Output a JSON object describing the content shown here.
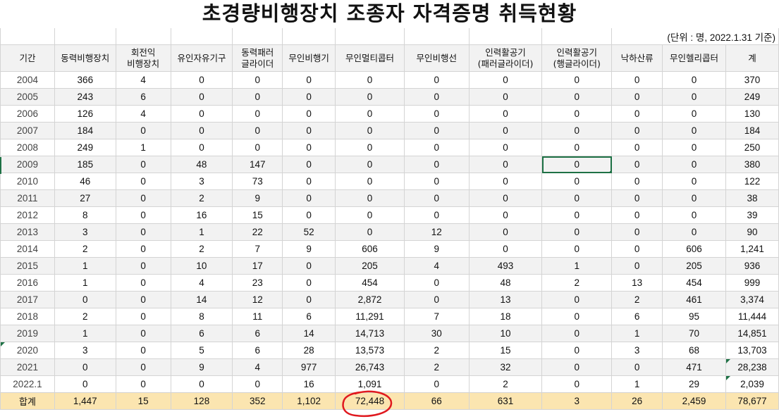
{
  "title": "초경량비행장치 조종자 자격증명 취득현황",
  "unit_note": "(단위 : 명, 2022.1.31 기준)",
  "headers": [
    "기간",
    "동력비행장치",
    "회전익\n비행장치",
    "유인자유기구",
    "동력패러\n글라이더",
    "무인비행기",
    "무인멀티콥터",
    "무인비행선",
    "인력활공기\n(패러글라이더)",
    "인력활공기\n(행글라이더)",
    "낙하산류",
    "무인헬리콥터",
    "계"
  ],
  "rows": [
    [
      "2004",
      "366",
      "4",
      "0",
      "0",
      "0",
      "0",
      "0",
      "0",
      "0",
      "0",
      "0",
      "370"
    ],
    [
      "2005",
      "243",
      "6",
      "0",
      "0",
      "0",
      "0",
      "0",
      "0",
      "0",
      "0",
      "0",
      "249"
    ],
    [
      "2006",
      "126",
      "4",
      "0",
      "0",
      "0",
      "0",
      "0",
      "0",
      "0",
      "0",
      "0",
      "130"
    ],
    [
      "2007",
      "184",
      "0",
      "0",
      "0",
      "0",
      "0",
      "0",
      "0",
      "0",
      "0",
      "0",
      "184"
    ],
    [
      "2008",
      "249",
      "1",
      "0",
      "0",
      "0",
      "0",
      "0",
      "0",
      "0",
      "0",
      "0",
      "250"
    ],
    [
      "2009",
      "185",
      "0",
      "48",
      "147",
      "0",
      "0",
      "0",
      "0",
      "0",
      "0",
      "0",
      "380"
    ],
    [
      "2010",
      "46",
      "0",
      "3",
      "73",
      "0",
      "0",
      "0",
      "0",
      "0",
      "0",
      "0",
      "122"
    ],
    [
      "2011",
      "27",
      "0",
      "2",
      "9",
      "0",
      "0",
      "0",
      "0",
      "0",
      "0",
      "0",
      "38"
    ],
    [
      "2012",
      "8",
      "0",
      "16",
      "15",
      "0",
      "0",
      "0",
      "0",
      "0",
      "0",
      "0",
      "39"
    ],
    [
      "2013",
      "3",
      "0",
      "1",
      "22",
      "52",
      "0",
      "12",
      "0",
      "0",
      "0",
      "0",
      "90"
    ],
    [
      "2014",
      "2",
      "0",
      "2",
      "7",
      "9",
      "606",
      "9",
      "0",
      "0",
      "0",
      "606",
      "1,241"
    ],
    [
      "2015",
      "1",
      "0",
      "10",
      "17",
      "0",
      "205",
      "4",
      "493",
      "1",
      "0",
      "205",
      "936"
    ],
    [
      "2016",
      "1",
      "0",
      "4",
      "23",
      "0",
      "454",
      "0",
      "48",
      "2",
      "13",
      "454",
      "999"
    ],
    [
      "2017",
      "0",
      "0",
      "14",
      "12",
      "0",
      "2,872",
      "0",
      "13",
      "0",
      "2",
      "461",
      "3,374"
    ],
    [
      "2018",
      "2",
      "0",
      "8",
      "11",
      "6",
      "11,291",
      "7",
      "18",
      "0",
      "6",
      "95",
      "11,444"
    ],
    [
      "2019",
      "1",
      "0",
      "6",
      "6",
      "14",
      "14,713",
      "30",
      "10",
      "0",
      "1",
      "70",
      "14,851"
    ],
    [
      "2020",
      "3",
      "0",
      "5",
      "6",
      "28",
      "13,573",
      "2",
      "15",
      "0",
      "3",
      "68",
      "13,703"
    ],
    [
      "2021",
      "0",
      "0",
      "9",
      "4",
      "977",
      "26,743",
      "2",
      "32",
      "0",
      "0",
      "471",
      "28,238"
    ],
    [
      "2022.1",
      "0",
      "0",
      "0",
      "0",
      "16",
      "1,091",
      "0",
      "2",
      "0",
      "1",
      "29",
      "2,039"
    ]
  ],
  "total": [
    "합계",
    "1,447",
    "15",
    "128",
    "352",
    "1,102",
    "72,448",
    "66",
    "631",
    "3",
    "26",
    "2,459",
    "78,677"
  ],
  "selected_cell": {
    "row": 5,
    "col": 9
  },
  "accent_color": "#1e7145",
  "annotation_color": "#e0191f"
}
